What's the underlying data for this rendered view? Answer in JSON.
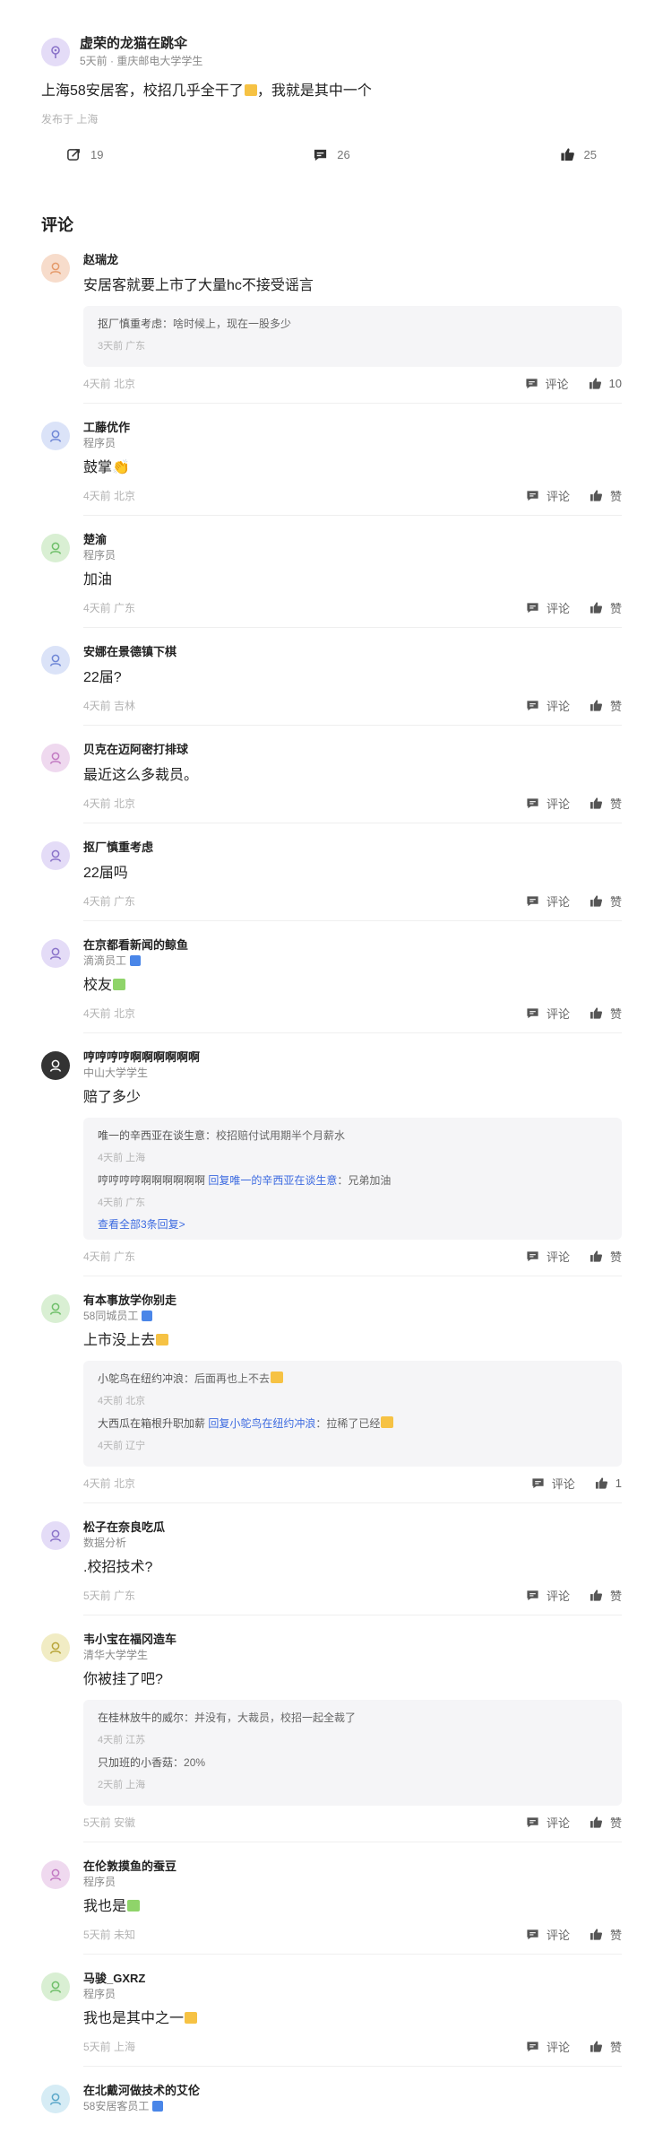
{
  "post": {
    "author": "虚荣的龙猫在跳伞",
    "meta": "5天前 · 重庆邮电大学学生",
    "content": "上海58安居客，校招几乎全干了",
    "content_tail": "，我就是其中一个",
    "location": "发布于 上海",
    "stats": {
      "share": "19",
      "comments": "26",
      "likes": "25"
    }
  },
  "comments_title": "评论",
  "comments": [
    {
      "name": "赵瑞龙",
      "role": "",
      "text": "安居客就要上市了大量hc不接受谣言",
      "replies": [
        {
          "from": "抠厂慎重考虑",
          "to": "",
          "text": "啥时候上，现在一股多少",
          "meta": "3天前 广东"
        }
      ],
      "more": "",
      "meta": "4天前 北京",
      "comment_label": "评论",
      "like_label": "10"
    },
    {
      "name": "工藤优作",
      "role": "程序员",
      "text": "鼓掌👏",
      "replies": [],
      "more": "",
      "meta": "4天前 北京",
      "comment_label": "评论",
      "like_label": "赞"
    },
    {
      "name": "楚渝",
      "role": "程序员",
      "text": "加油",
      "replies": [],
      "more": "",
      "meta": "4天前 广东",
      "comment_label": "评论",
      "like_label": "赞"
    },
    {
      "name": "安娜在景德镇下棋",
      "role": "",
      "text": "22届?",
      "replies": [],
      "more": "",
      "meta": "4天前 吉林",
      "comment_label": "评论",
      "like_label": "赞"
    },
    {
      "name": "贝克在迈阿密打排球",
      "role": "",
      "text": "最近这么多裁员。",
      "replies": [],
      "more": "",
      "meta": "4天前 北京",
      "comment_label": "评论",
      "like_label": "赞"
    },
    {
      "name": "抠厂慎重考虑",
      "role": "",
      "text": "22届吗",
      "replies": [],
      "more": "",
      "meta": "4天前 广东",
      "comment_label": "评论",
      "like_label": "赞"
    },
    {
      "name": "在京都看新闻的鲸鱼",
      "role": "滴滴员工",
      "badge": true,
      "text": "校友",
      "emoji": "green",
      "replies": [],
      "more": "",
      "meta": "4天前 北京",
      "comment_label": "评论",
      "like_label": "赞"
    },
    {
      "name": "哼哼哼哼啊啊啊啊啊啊",
      "role": "中山大学学生",
      "text": "赔了多少",
      "replies": [
        {
          "from": "唯一的辛西亚在谈生意",
          "to": "",
          "text": "校招赔付试用期半个月薪水",
          "meta": "4天前 上海"
        },
        {
          "from": "哼哼哼哼啊啊啊啊啊啊",
          "to": "回复唯一的辛西亚在谈生意",
          "text": "兄弟加油",
          "meta": "4天前 广东"
        }
      ],
      "more": "查看全部3条回复>",
      "meta": "4天前 广东",
      "comment_label": "评论",
      "like_label": "赞"
    },
    {
      "name": "有本事放学你别走",
      "role": "58同城员工",
      "badge": true,
      "text": "上市没上去",
      "emoji": "yellow",
      "replies": [
        {
          "from": "小鸵鸟在纽约冲浪",
          "to": "",
          "text": "后面再也上不去",
          "emoji": "yellow",
          "meta": "4天前 北京"
        },
        {
          "from": "大西瓜在箱根升职加薪",
          "to": "回复小鸵鸟在纽约冲浪",
          "text": "拉稀了已经",
          "emoji": "yellow",
          "meta": "4天前 辽宁"
        }
      ],
      "more": "",
      "meta": "4天前 北京",
      "comment_label": "评论",
      "like_label": "1"
    },
    {
      "name": "松子在奈良吃瓜",
      "role": "数据分析",
      "text": ".校招技术?",
      "replies": [],
      "more": "",
      "meta": "5天前 广东",
      "comment_label": "评论",
      "like_label": "赞"
    },
    {
      "name": "韦小宝在福冈造车",
      "role": "清华大学学生",
      "text": "你被挂了吧?",
      "replies": [
        {
          "from": "在桂林放牛的威尔",
          "to": "",
          "text": "并没有，大裁员，校招一起全裁了",
          "meta": "4天前 江苏"
        },
        {
          "from": "只加班的小香菇",
          "to": "",
          "text": "20%",
          "meta": "2天前 上海"
        }
      ],
      "more": "",
      "meta": "5天前 安徽",
      "comment_label": "评论",
      "like_label": "赞"
    },
    {
      "name": "在伦敦摸鱼的蚕豆",
      "role": "程序员",
      "text": "我也是",
      "emoji": "green",
      "replies": [],
      "more": "",
      "meta": "5天前 未知",
      "comment_label": "评论",
      "like_label": "赞"
    },
    {
      "name": "马骏_GXRZ",
      "role": "程序员",
      "text": "我也是其中之一",
      "emoji": "yellow",
      "replies": [],
      "more": "",
      "meta": "5天前 上海",
      "comment_label": "评论",
      "like_label": "赞"
    },
    {
      "name": "在北戴河做技术的艾伦",
      "role": "58安居客员工",
      "badge": true,
      "text": "",
      "replies": [],
      "more": "",
      "meta": "",
      "comment_label": "",
      "like_label": ""
    }
  ],
  "colors": {
    "accent_link": "#3c6ae0",
    "avatar_purple": "#e4dcf7",
    "avatar_blue": "#dbe3f8",
    "avatar_green": "#d9efd3",
    "avatar_orange": "#f7dccb",
    "avatar_yellow": "#f1ecc4",
    "avatar_dark": "#333333"
  }
}
